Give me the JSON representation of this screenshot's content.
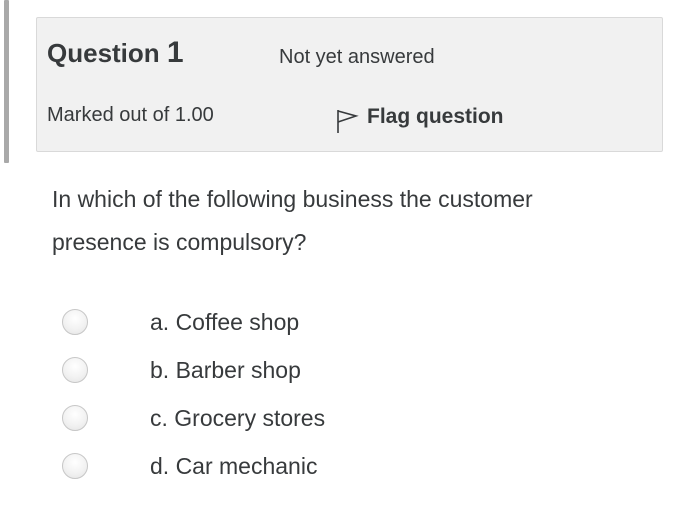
{
  "question": {
    "title_word": "Question",
    "number": "1",
    "state": "Not yet answered",
    "grade": "Marked out of 1.00",
    "flag_label": "Flag question",
    "text": "In which of the following business the customer presence is compulsory?"
  },
  "answers": [
    {
      "label": "a. Coffee shop",
      "selected": false
    },
    {
      "label": "b. Barber shop",
      "selected": false
    },
    {
      "label": "c. Grocery stores",
      "selected": false
    },
    {
      "label": "d. Car mechanic",
      "selected": false
    }
  ],
  "icons": {
    "flag": "flag-icon",
    "radio": "radio-button"
  },
  "colors": {
    "info_background": "#f1f1f1",
    "text": "#373a3c",
    "left_rule": "#a9a9a9"
  }
}
